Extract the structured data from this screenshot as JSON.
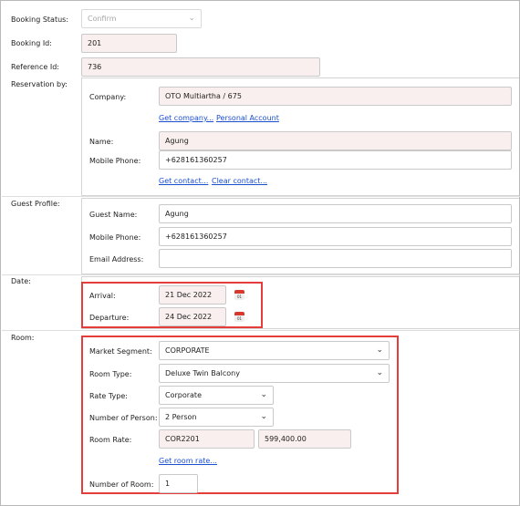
{
  "booking_status": {
    "label": "Booking Status:",
    "value": "Confirm"
  },
  "booking_id": {
    "label": "Booking Id:",
    "value": "201"
  },
  "reference_id": {
    "label": "Reference Id:",
    "value": "736"
  },
  "reservation_by": {
    "label": "Reservation by:",
    "company": {
      "label": "Company:",
      "value": "OTO Multiartha / 675"
    },
    "get_company_link": "Get company...",
    "personal_account_link": "Personal Account",
    "name": {
      "label": "Name:",
      "value": "Agung"
    },
    "mobile": {
      "label": "Mobile Phone:",
      "value": "+628161360257"
    },
    "get_contact_link": "Get contact...",
    "clear_contact_link": "Clear contact..."
  },
  "guest_profile": {
    "label": "Guest Profile:",
    "guest_name": {
      "label": "Guest Name:",
      "value": "Agung"
    },
    "mobile": {
      "label": "Mobile Phone:",
      "value": "+628161360257"
    },
    "email": {
      "label": "Email Address:",
      "value": ""
    }
  },
  "date": {
    "label": "Date:",
    "arrival": {
      "label": "Arrival:",
      "value": "21 Dec 2022"
    },
    "departure": {
      "label": "Departure:",
      "value": "24 Dec 2022"
    },
    "calendar_day": "01"
  },
  "room": {
    "label": "Room:",
    "market_segment": {
      "label": "Market Segment:",
      "value": "CORPORATE"
    },
    "room_type": {
      "label": "Room Type:",
      "value": "Deluxe Twin Balcony"
    },
    "rate_type": {
      "label": "Rate Type:",
      "value": "Corporate"
    },
    "number_of_person": {
      "label": "Number of Person:",
      "value": "2 Person"
    },
    "room_rate": {
      "label": "Room Rate:",
      "code": "COR2201",
      "amount": "599,400.00"
    },
    "get_room_rate_link": "Get room rate...",
    "number_of_room": {
      "label": "Number of Room:",
      "value": "1"
    }
  },
  "colors": {
    "highlight": "#e53c3c",
    "link": "#1a4fd0",
    "readonly_bg": "#f8efee"
  }
}
